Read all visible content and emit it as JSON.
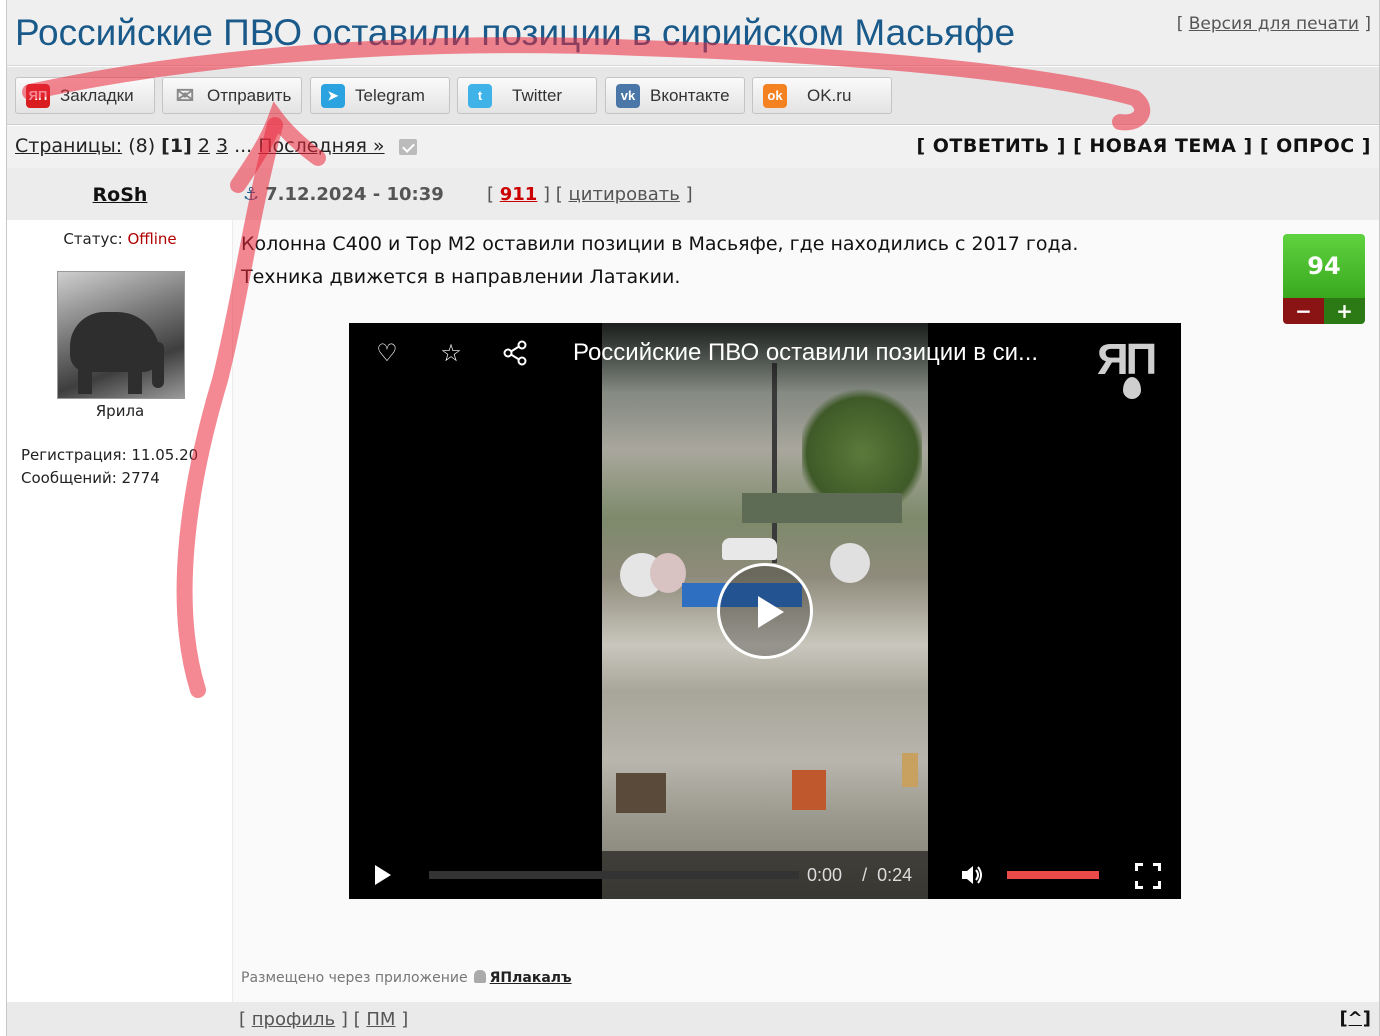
{
  "header": {
    "title": "Российские ПВО оставили позиции в сирийском Масьяфе",
    "print_open": "[ ",
    "print_label": "Версия для печати",
    "print_close": " ]"
  },
  "share": {
    "buttons": [
      {
        "label": "Закладки",
        "icon": "yap-icon",
        "icon_text": "ЯП",
        "color": "#d81e1e"
      },
      {
        "label": "Отправить",
        "icon": "mail-icon",
        "icon_text": "✉",
        "color": "#9a9a9a"
      },
      {
        "label": "Telegram",
        "icon": "telegram-icon",
        "icon_text": "➤",
        "color": "#2aa3e0"
      },
      {
        "label": "Twitter",
        "icon": "twitter-icon",
        "icon_text": "t",
        "color": "#3fb2e8"
      },
      {
        "label": "Вконтакте",
        "icon": "vk-icon",
        "icon_text": "vk",
        "color": "#4a76a8"
      },
      {
        "label": "OK.ru",
        "icon": "ok-icon",
        "icon_text": "ok",
        "color": "#f58220"
      }
    ]
  },
  "pagination": {
    "label": "Страницы:",
    "count": "(8)",
    "current": "[1]",
    "page2": "2",
    "page3": "3",
    "ellipsis": "...",
    "last": "Последняя »"
  },
  "actions": {
    "text": "[ ОТВЕТИТЬ ] [ НОВАЯ ТЕМА ] [ ОПРОС ]"
  },
  "author": {
    "name": "RoSh",
    "status_label": "Статус:",
    "status_value": "Offline",
    "group": "Ярила",
    "registration": "Регистрация: 11.05.20",
    "messages": "Сообщений: 2774"
  },
  "post": {
    "date": "7.12.2024 - 10:39",
    "meta_open": "[ ",
    "number": "911",
    "meta_mid": " ] [ ",
    "quote": "цитировать",
    "meta_close": " ]",
    "line1": "Колонна С400 и Тор М2 оставили позиции в Масьяфе, где находились с 2017 года.",
    "line2": "Техника движется в направлении Латакии.",
    "rating": "94",
    "minus": "−",
    "plus": "+",
    "posted_via_label": "Размещено через приложение",
    "app_name": "ЯПлакалъ"
  },
  "video": {
    "title": "Российские ПВО оставили позиции в си...",
    "logo": "ЯП",
    "time_current": "0:00",
    "time_sep": "/",
    "time_total": "0:24",
    "progress": 0,
    "volume": 1.0,
    "accent": "#e84a4a"
  },
  "footer": {
    "open": "[ ",
    "profile": "профиль",
    "mid": " ] [ ",
    "pm": "ПМ",
    "close": " ]",
    "to_top": "[^]"
  }
}
